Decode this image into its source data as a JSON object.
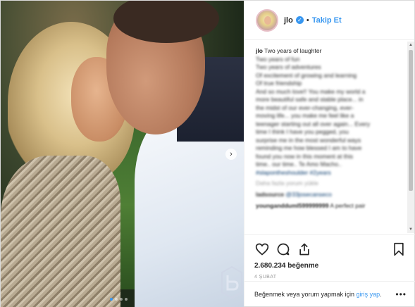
{
  "header": {
    "username": "jlo",
    "separator": "•",
    "follow_label": "Takip Et",
    "verified_icon": "verified-badge-icon"
  },
  "caption": {
    "author": "jlo",
    "lines": [
      "Two years of laughter",
      "Two years of fun",
      "Two years of adventures",
      "Of excitement of growing and learning",
      "Of true friendship",
      "And so much love!! You make my world a",
      "more beautiful safe and stable place... in",
      "the midst of our ever-changing, ever-",
      "moving life... you make me feel like a",
      "teenager starting out all over again... Every",
      "time I think I have you pegged, you",
      "surprise me in the most wonderful ways",
      "reminding me how blessed I am to have",
      "found you now in this moment at this",
      "time.. our time.. Te Amo Macho..",
      "#slapontheshoulder #2years"
    ]
  },
  "load_more": "Daha fazla yorum yükle",
  "comments": [
    {
      "author": "ladsource",
      "mention": "@33josecanseco",
      "text": ""
    },
    {
      "author": "youngandduml599999999",
      "mention": "",
      "text": "A perfect pair"
    }
  ],
  "likes": "2.680.234 beğenme",
  "date": "4 ŞUBAT",
  "add_comment": {
    "prefix": "Beğenmek veya yorum yapmak için ",
    "link": "giriş yap",
    "suffix": "."
  },
  "more_label": "•••",
  "photo": {
    "nav_next": "›",
    "slide_count": 4,
    "active_slide": 1
  },
  "colors": {
    "accent": "#3897f0",
    "text": "#262626",
    "muted": "#999999"
  }
}
